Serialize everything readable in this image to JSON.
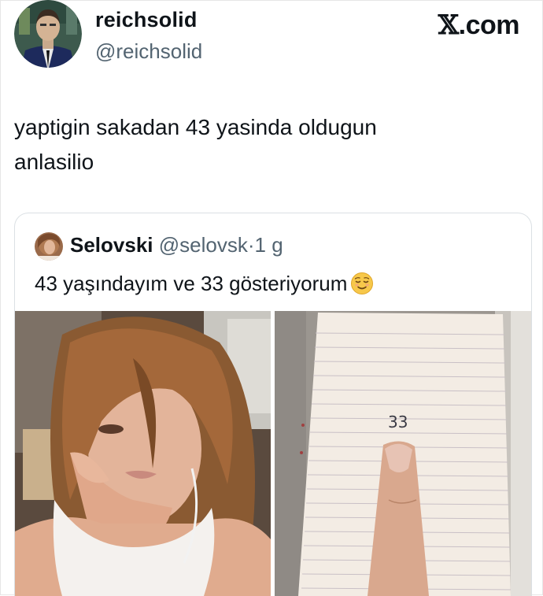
{
  "brand": {
    "label": "X.com"
  },
  "author": {
    "name": "reichsolid",
    "handle": "@reichsolid"
  },
  "tweet": {
    "line1": "yaptigin sakadan 43 yasinda oldugun",
    "line2": "anlasilio"
  },
  "quote": {
    "name": "Selovski",
    "handle": "@selovsk",
    "separator": "·",
    "time": "1 g",
    "text": "43 yaşındayım ve 33 gösteriyorum",
    "emoji_icon": "relieved-face-icon"
  },
  "media": {
    "left_image": "selfie-photo",
    "right_image": "notebook-photo",
    "notebook_text": "33"
  },
  "colors": {
    "secondary_text": "#536471",
    "border": "#dbe0e4",
    "primary_text": "#0f1419"
  }
}
